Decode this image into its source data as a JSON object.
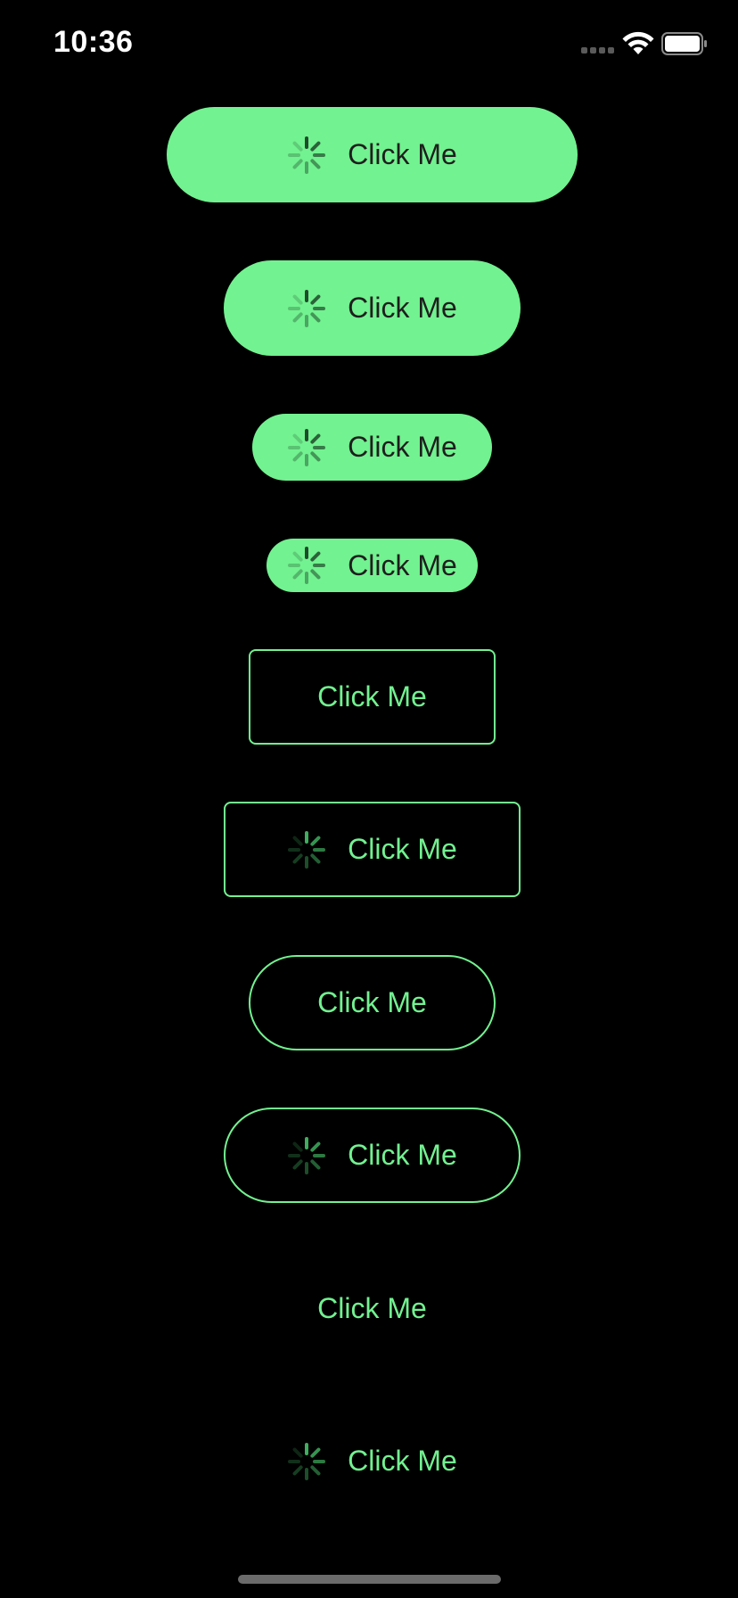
{
  "status_bar": {
    "time": "10:36",
    "icons": [
      "cellular-signal-icon",
      "wifi-icon",
      "battery-icon"
    ]
  },
  "colors": {
    "background": "#000000",
    "accent": "#72f290",
    "filled_text": "#1e1e1e"
  },
  "buttons": [
    {
      "label": "Click Me",
      "style": "filled",
      "shape": "pill",
      "loading": true
    },
    {
      "label": "Click Me",
      "style": "filled",
      "shape": "pill",
      "loading": true
    },
    {
      "label": "Click Me",
      "style": "filled",
      "shape": "pill",
      "loading": true
    },
    {
      "label": "Click Me",
      "style": "filled",
      "shape": "pill",
      "loading": true
    },
    {
      "label": "Click Me",
      "style": "outlined",
      "shape": "rect",
      "loading": false
    },
    {
      "label": "Click Me",
      "style": "outlined",
      "shape": "rect",
      "loading": true
    },
    {
      "label": "Click Me",
      "style": "outlined",
      "shape": "pill",
      "loading": false
    },
    {
      "label": "Click Me",
      "style": "outlined",
      "shape": "pill",
      "loading": true
    },
    {
      "label": "Click Me",
      "style": "text",
      "shape": "none",
      "loading": false
    },
    {
      "label": "Click Me",
      "style": "text",
      "shape": "none",
      "loading": true
    }
  ]
}
